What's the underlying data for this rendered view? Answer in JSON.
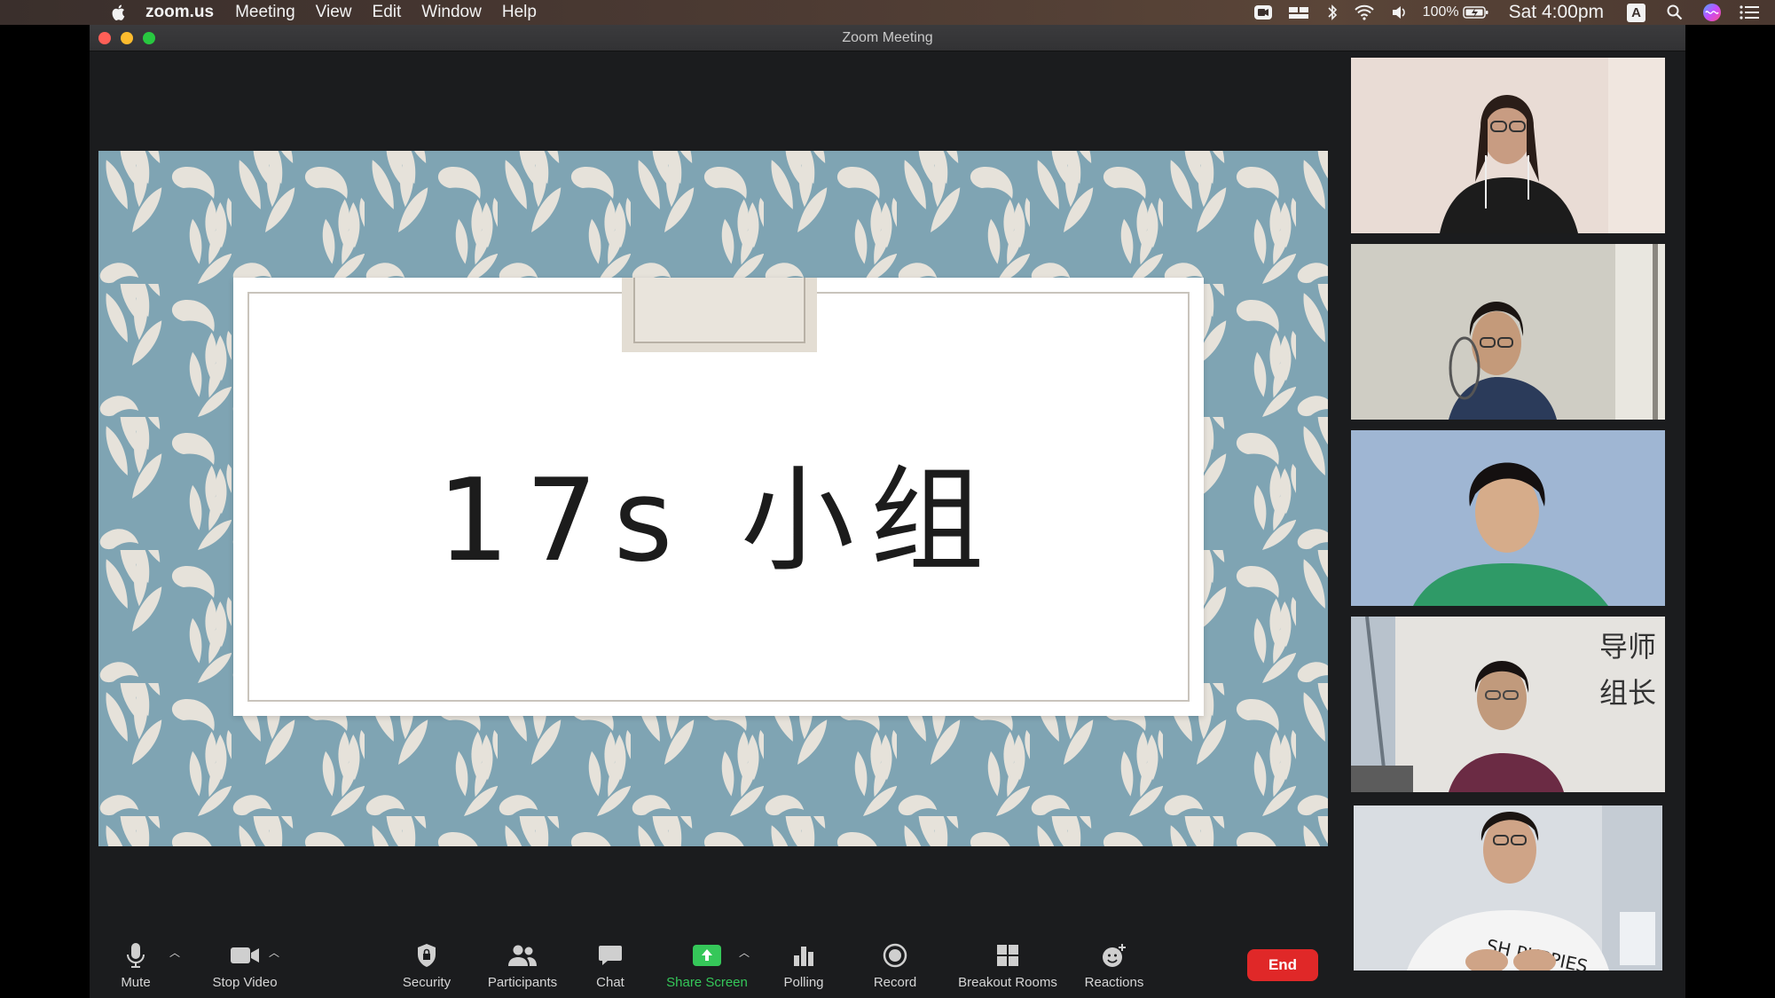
{
  "menubar": {
    "app_name": "zoom.us",
    "items": [
      "Meeting",
      "View",
      "Edit",
      "Window",
      "Help"
    ],
    "battery": "100%",
    "clock": "Sat 4:00pm",
    "input_source": "A"
  },
  "window": {
    "title": "Zoom Meeting"
  },
  "slide": {
    "text": "17s 小组",
    "bg_color": "#7fa4b3",
    "leaf_color": "#e6e2da"
  },
  "participants": [
    {
      "overlay": ""
    },
    {
      "overlay": ""
    },
    {
      "overlay": ""
    },
    {
      "overlay": "导师\n组长"
    },
    {
      "overlay": ""
    }
  ],
  "toolbar": {
    "mute": "Mute",
    "stop_video": "Stop Video",
    "security": "Security",
    "participants": "Participants",
    "chat": "Chat",
    "share_screen": "Share Screen",
    "polling": "Polling",
    "record": "Record",
    "breakout_rooms": "Breakout Rooms",
    "reactions": "Reactions",
    "end": "End"
  },
  "colors": {
    "share_green": "#35c759",
    "end_red": "#e02828"
  }
}
